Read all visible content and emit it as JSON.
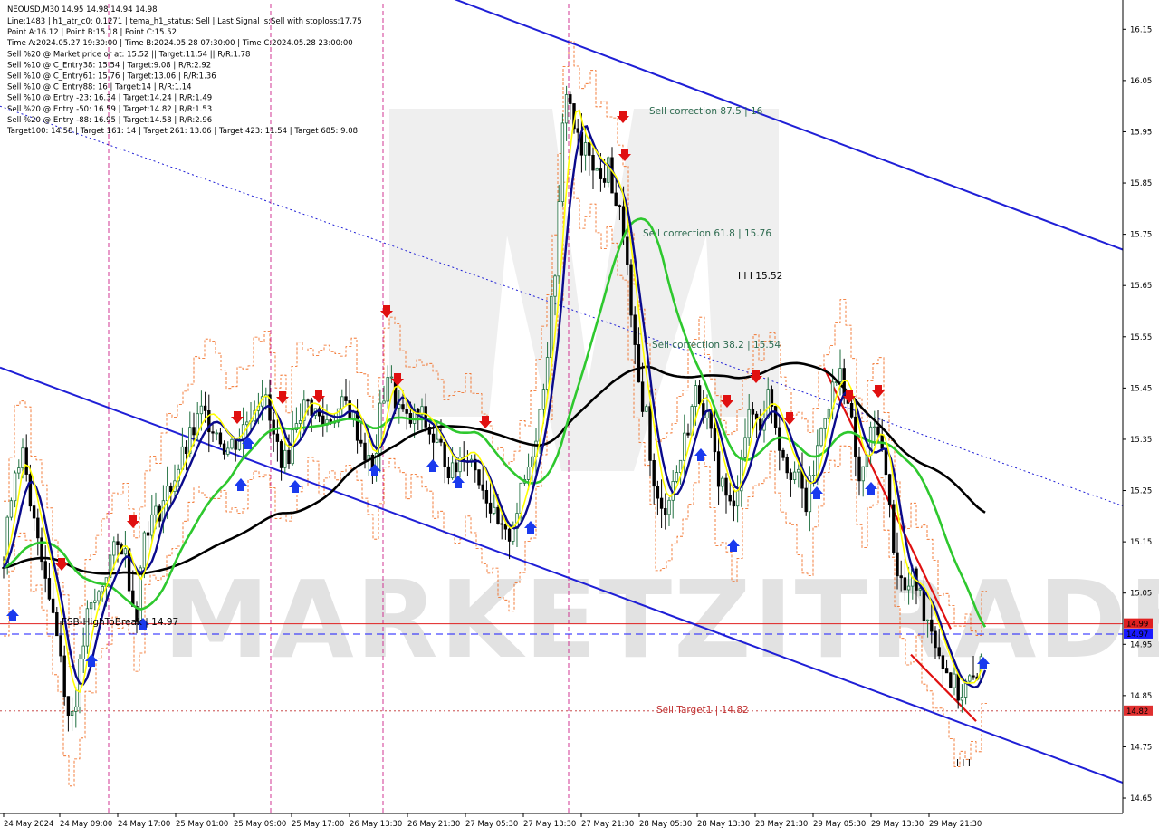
{
  "chart_data": {
    "type": "candlestick",
    "symbol_header": "NEOUSD,M30  14.95 14.98 14.94 14.98",
    "info_lines": [
      "Line:1483  |  h1_atr_c0: 0.1271  |  tema_h1_status: Sell  |  Last Signal is:Sell with stoploss:17.75",
      "Point A:16.12  |  Point B:15.18  |  Point C:15.52",
      "Time A:2024.05.27 19:30:00  |  Time B:2024.05.28 07:30:00  |  Time C:2024.05.28 23:00:00",
      "Sell %20 @ Market price or at: 15.52  ||  Target:11.54  ||  R/R:1.78",
      "Sell %10 @ C_Entry38: 15.54  |  Target:9.08  |  R/R:2.92",
      "Sell %10 @ C_Entry61: 15.76  |  Target:13.06  |  R/R:1.36",
      "Sell %10 @ C_Entry88: 16  |  Target:14  |  R/R:1.14",
      "Sell %10 @ Entry -23: 16.34  |  Target:14.24  |  R/R:1.49",
      "Sell %20 @ Entry -50: 16.59  |  Target:14.82  |  R/R:1.53",
      "Sell %20 @ Entry -88: 16.95  |  Target:14.58  |  R/R:2.96",
      "Target100: 14.58  |  Target 161: 14  |  Target 261: 13.06  |  Target 423: 11.54  |  Target 685: 9.08"
    ],
    "y_ticks": [
      "16.15",
      "16.05",
      "15.95",
      "15.85",
      "15.75",
      "15.65",
      "15.55",
      "15.45",
      "15.35",
      "15.25",
      "15.15",
      "15.05",
      "14.95",
      "14.85",
      "14.75",
      "14.65"
    ],
    "ylim": [
      14.62,
      16.2
    ],
    "x_ticks": [
      "24 May 2024",
      "24 May 09:00",
      "24 May 17:00",
      "25 May 01:00",
      "25 May 09:00",
      "25 May 17:00",
      "26 May 13:30",
      "26 May 21:30",
      "27 May 05:30",
      "27 May 13:30",
      "27 May 21:30",
      "28 May 05:30",
      "28 May 13:30",
      "28 May 21:30",
      "29 May 05:30",
      "29 May 13:30",
      "29 May 21:30"
    ],
    "price_tags": [
      {
        "label": "14.99",
        "value": 14.99,
        "color": "#e02020"
      },
      {
        "label": "14.97",
        "value": 14.97,
        "color": "#1a1aff"
      },
      {
        "label": "14.82",
        "value": 14.82,
        "color": "#e03030"
      }
    ],
    "annotations": [
      {
        "text": "Sell correction 87.5 | 16",
        "value": 15.96,
        "color": "#2e6b50"
      },
      {
        "text": "Sell correction 61.8 | 15.76",
        "value": 15.76,
        "color": "#2e6b50"
      },
      {
        "text": "Sell correction 38.2 | 15.54",
        "value": 15.54,
        "color": "#2e6b50"
      },
      {
        "text": "I I I 15.52",
        "value": 15.52,
        "color": "#000000"
      },
      {
        "text": "FSB-HighToBreak | 14.97",
        "value": 14.97,
        "color": "#000000"
      },
      {
        "text": "Sell Target1 | 14.82",
        "value": 14.82,
        "color": "#c03030"
      },
      {
        "text": "I I I",
        "value": 14.71,
        "color": "#000000"
      }
    ],
    "watermark": "MARKETZITRADE",
    "colors": {
      "bull_candle": "#1f6f3f",
      "bear_candle": "#000000",
      "ema_slow": "#000000",
      "ema_mid": "#2ec82e",
      "ema_fast_blue": "#0a0a8c",
      "ema_fast_yellow": "#ffff00",
      "channel": "#1f1fd6",
      "vertical_lines": "#cc2288",
      "atr_band": "#f06010",
      "sell_arrow": "#e01010",
      "buy_arrow": "#1a3aee"
    }
  }
}
